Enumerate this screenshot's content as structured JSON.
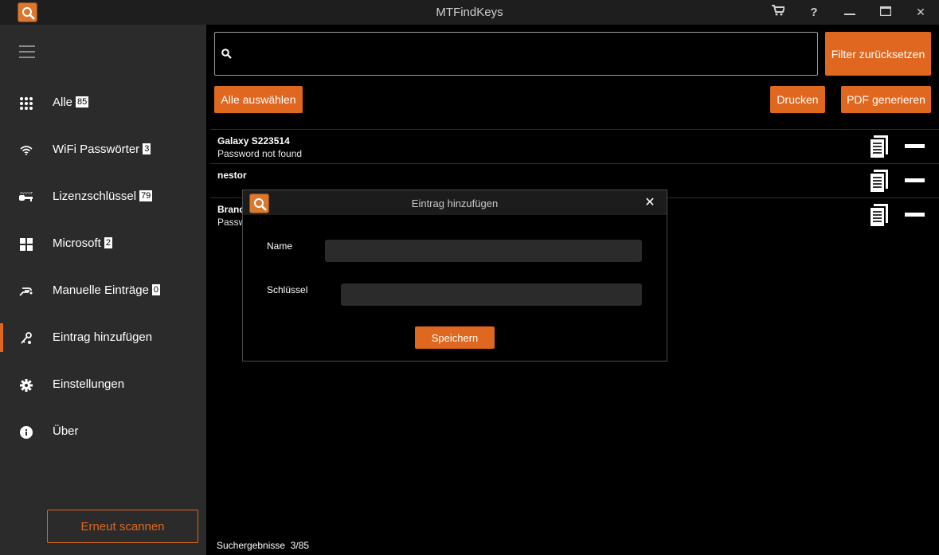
{
  "window": {
    "title": "MTFindKeys",
    "buttons": [
      {
        "icon": "cart-icon"
      },
      {
        "icon": "help-icon",
        "glyph": "?"
      },
      {
        "icon": "minimize-icon"
      },
      {
        "icon": "maximize-icon"
      },
      {
        "icon": "close-icon",
        "glyph": "✕"
      }
    ]
  },
  "sidebar": {
    "items": [
      {
        "label": "Alle",
        "badge": "85",
        "icon": "grid-icon"
      },
      {
        "label": "WiFi Passwörter",
        "badge": "3",
        "icon": "wifi-icon"
      },
      {
        "label": "Lizenzschlüssel",
        "badge": "79",
        "icon": "key-icon"
      },
      {
        "label": "Microsoft",
        "badge": "2",
        "icon": "windows-icon"
      },
      {
        "label": "Manuelle Einträge",
        "badge": "0",
        "icon": "hand-icon"
      },
      {
        "label": "Eintrag hinzufügen",
        "badge": "",
        "icon": "add-key-icon",
        "active": true
      },
      {
        "label": "Einstellungen",
        "badge": "",
        "icon": "gear-icon"
      },
      {
        "label": "Über",
        "badge": "",
        "icon": "info-icon"
      }
    ],
    "rescan_label": "Erneut scannen"
  },
  "search": {
    "placeholder": "",
    "value": ""
  },
  "toolbar": {
    "reset_filter": "Filter zurücksetzen",
    "select_all": "Alle auswählen",
    "print": "Drucken",
    "pdf": "PDF generieren"
  },
  "entries": [
    {
      "name": "Galaxy S223514",
      "detail": "Password not found"
    },
    {
      "name": "nestor",
      "detail": ""
    },
    {
      "name": "Brand",
      "detail": "Passw"
    }
  ],
  "status": {
    "results_label": "Suchergebnisse",
    "results_value": "3/85"
  },
  "dialog": {
    "title": "Eintrag hinzufügen",
    "close_glyph": "✕",
    "name_label": "Name",
    "name_value": "",
    "key_label": "Schlüssel",
    "key_value": "",
    "save_label": "Speichern"
  },
  "colors": {
    "accent": "#e0671f",
    "sidebar": "#2b2b2b",
    "titlebar": "#1e1e1e",
    "background": "#000000"
  }
}
